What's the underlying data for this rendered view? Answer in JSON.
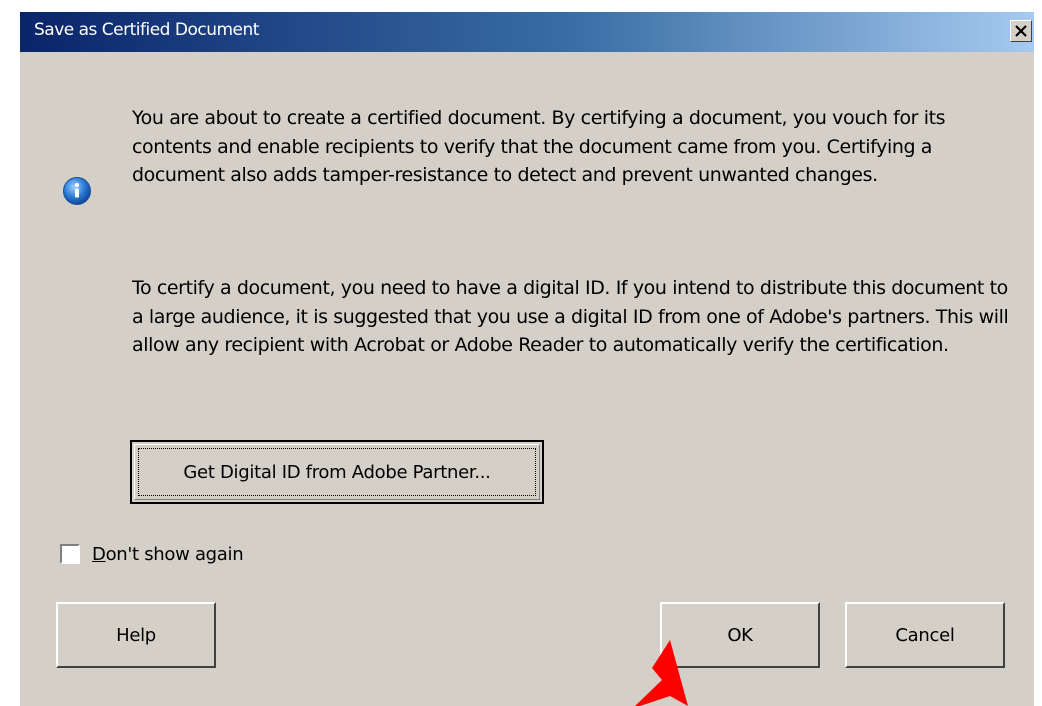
{
  "window": {
    "title": "Save as Certified Document",
    "close_icon": "close-icon"
  },
  "message": {
    "icon": "info-icon",
    "paragraph1": "You are about to create a certified document. By certifying a document, you vouch for its contents and enable recipients to verify that the document came from you. Certifying a document also adds tamper-resistance to detect and prevent unwanted changes.",
    "paragraph2": "To certify a document, you need to have a digital ID. If you intend to distribute this document to a large audience, it is suggested that you use a digital ID from one of Adobe's partners. This will allow any recipient with Acrobat or Adobe Reader to automatically verify the certification."
  },
  "buttons": {
    "get_digital_id": "Get Digital ID from Adobe Partner...",
    "help": "Help",
    "ok": "OK",
    "cancel": "Cancel"
  },
  "dont_show_again": {
    "mnemonic": "D",
    "label_rest": "on't show again",
    "checked": false
  },
  "annotation": {
    "arrow_icon": "red-arrow-icon",
    "color": "#ff0000"
  },
  "colors": {
    "dialog_bg": "#d4d0c8",
    "titlebar_start": "#0a246a",
    "titlebar_end": "#a6caf0",
    "info_icon": "#2a78d4"
  }
}
